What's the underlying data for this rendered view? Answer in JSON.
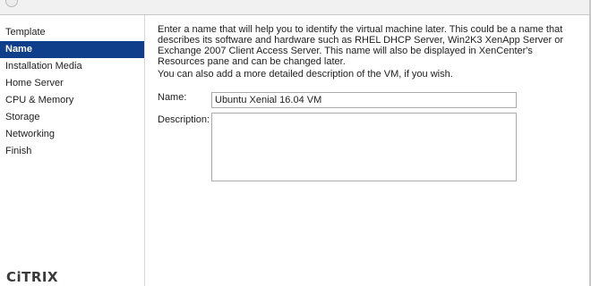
{
  "nav": {
    "items": [
      {
        "label": "Template"
      },
      {
        "label": "Name"
      },
      {
        "label": "Installation Media"
      },
      {
        "label": "Home Server"
      },
      {
        "label": "CPU & Memory"
      },
      {
        "label": "Storage"
      },
      {
        "label": "Networking"
      },
      {
        "label": "Finish"
      }
    ],
    "active_index": 1,
    "active_color": "#0f3e8b"
  },
  "logo": {
    "text": "CiTRIX"
  },
  "content": {
    "intro": "Enter a name that will help you to identify the virtual machine later. This could be a name that describes its software and hardware such as RHEL DHCP Server, Win2K3 XenApp Server or Exchange 2007 Client Access Server. This name will also be displayed in XenCenter's Resources pane and can be changed later.",
    "intro2": "You can also add a more detailed description of the VM, if you wish.",
    "name_label": "Name:",
    "name_value": "Ubuntu Xenial 16.04 VM",
    "description_label": "Description:",
    "description_value": ""
  }
}
